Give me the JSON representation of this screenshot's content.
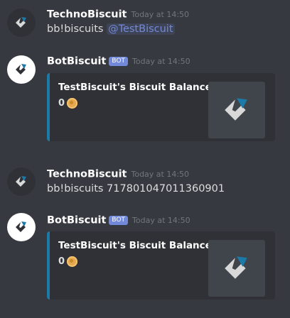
{
  "messages": [
    {
      "author": "TechnoBiscuit",
      "timestamp": "Today at 14:50",
      "text": "bb!biscuits ",
      "mention": "@TestBiscuit"
    },
    {
      "author": "BotBiscuit",
      "bot_tag": "BOT",
      "timestamp": "Today at 14:50",
      "embed": {
        "title": "TestBiscuit's Biscuit Balance",
        "balance": "0",
        "accent_color": "#1b7aa8"
      }
    },
    {
      "author": "TechnoBiscuit",
      "timestamp": "Today at 14:50",
      "text": "bb!biscuits 717801047011360901"
    },
    {
      "author": "BotBiscuit",
      "bot_tag": "BOT",
      "timestamp": "Today at 14:50",
      "embed": {
        "title": "TestBiscuit's Biscuit Balance",
        "balance": "0",
        "accent_color": "#1b7aa8"
      }
    }
  ],
  "icons": {
    "avatar_logo": "biscuit-logo-icon",
    "currency": "biscuit-coin-icon"
  },
  "colors": {
    "background": "#36393f",
    "embed_bg": "#2f3136",
    "mention": "#7289da",
    "bot_tag": "#7289da",
    "timestamp": "#72767d"
  }
}
